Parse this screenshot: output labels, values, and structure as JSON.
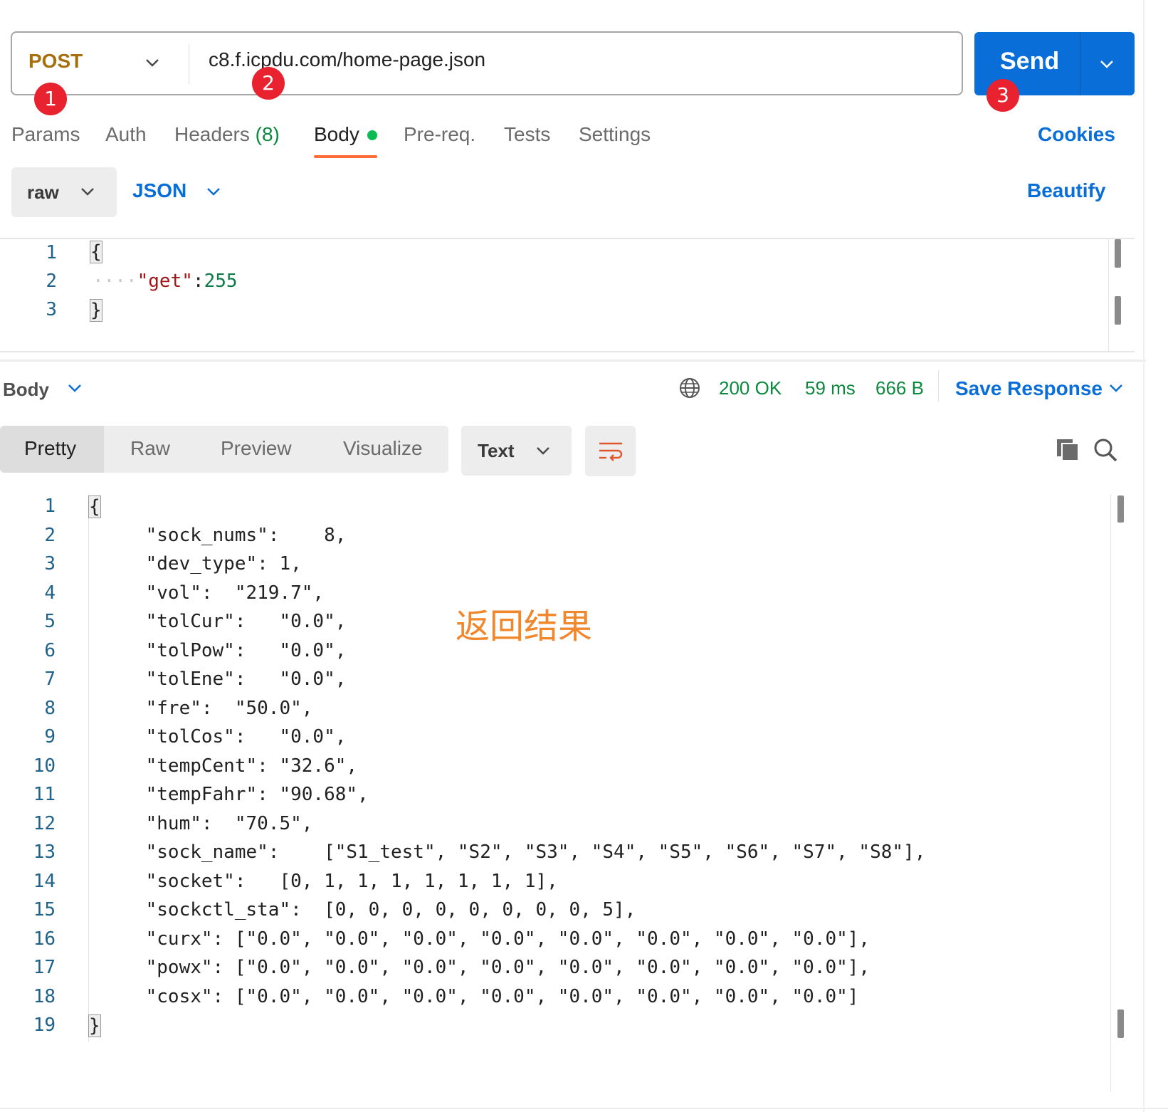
{
  "request": {
    "method": "POST",
    "url": "c8.f.icpdu.com/home-page.json",
    "send_label": "Send"
  },
  "badges": [
    "1",
    "2",
    "3"
  ],
  "tabs": [
    {
      "label": "Params"
    },
    {
      "label": "Auth"
    },
    {
      "label": "Headers",
      "count": "(8)"
    },
    {
      "label": "Body"
    },
    {
      "label": "Pre-req."
    },
    {
      "label": "Tests"
    },
    {
      "label": "Settings"
    }
  ],
  "cookies_label": "Cookies",
  "body_options": {
    "mode": "raw",
    "format": "JSON",
    "beautify_label": "Beautify"
  },
  "request_body": {
    "line_numbers": [
      "1",
      "2",
      "3"
    ],
    "open_brace": "{",
    "indent": "····",
    "key": "\"get\"",
    "colon": ":",
    "value": "255",
    "close_brace": "}"
  },
  "response": {
    "section_label": "Body",
    "status": "200 OK",
    "time": "59 ms",
    "size": "666 B",
    "save_label": "Save Response",
    "view_tabs": [
      "Pretty",
      "Raw",
      "Preview",
      "Visualize"
    ],
    "text_format": "Text",
    "line_numbers": [
      "1",
      "2",
      "3",
      "4",
      "5",
      "6",
      "7",
      "8",
      "9",
      "10",
      "11",
      "12",
      "13",
      "14",
      "15",
      "16",
      "17",
      "18",
      "19"
    ],
    "lines": [
      "{",
      "    \"sock_nums\":    8,",
      "    \"dev_type\": 1,",
      "    \"vol\":  \"219.7\",",
      "    \"tolCur\":   \"0.0\",",
      "    \"tolPow\":   \"0.0\",",
      "    \"tolEne\":   \"0.0\",",
      "    \"fre\":  \"50.0\",",
      "    \"tolCos\":   \"0.0\",",
      "    \"tempCent\": \"32.6\",",
      "    \"tempFahr\": \"90.68\",",
      "    \"hum\":  \"70.5\",",
      "    \"sock_name\":    [\"S1_test\", \"S2\", \"S3\", \"S4\", \"S5\", \"S6\", \"S7\", \"S8\"],",
      "    \"socket\":   [0, 1, 1, 1, 1, 1, 1, 1],",
      "    \"sockctl_sta\":  [0, 0, 0, 0, 0, 0, 0, 0, 5],",
      "    \"curx\": [\"0.0\", \"0.0\", \"0.0\", \"0.0\", \"0.0\", \"0.0\", \"0.0\", \"0.0\"],",
      "    \"powx\": [\"0.0\", \"0.0\", \"0.0\", \"0.0\", \"0.0\", \"0.0\", \"0.0\", \"0.0\"],",
      "    \"cosx\": [\"0.0\", \"0.0\", \"0.0\", \"0.0\", \"0.0\", \"0.0\", \"0.0\", \"0.0\"]",
      "}"
    ]
  },
  "annotation": "返回结果",
  "icons": [
    "chevron-down-icon",
    "globe-icon",
    "wrap-lines-icon",
    "copy-icon",
    "search-icon"
  ],
  "colors": {
    "accent": "#0a6ed8",
    "method": "#a6700e",
    "success": "#0b8a3e",
    "tab_underline": "#ff6c37",
    "badge": "#e8222e",
    "annotation": "#f0872c"
  }
}
